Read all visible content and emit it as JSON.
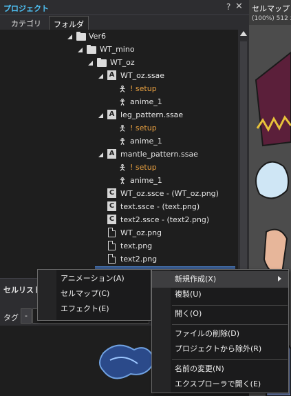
{
  "project_panel": {
    "title": "プロジェクト",
    "help": "?",
    "close": "✕",
    "tabs": [
      {
        "label": "カテゴリ"
      },
      {
        "label": "フォルダ"
      }
    ],
    "tree": [
      {
        "label": "Ver6"
      },
      {
        "label": "WT_mino"
      },
      {
        "label": "WT_oz"
      },
      {
        "label": "WT_oz.ssae",
        "badge": "A"
      },
      {
        "label": "! setup"
      },
      {
        "label": "anime_1"
      },
      {
        "label": "leg_pattern.ssae",
        "badge": "A"
      },
      {
        "label": "! setup"
      },
      {
        "label": "anime_1"
      },
      {
        "label": "mantle_pattern.ssae",
        "badge": "A"
      },
      {
        "label": "! setup"
      },
      {
        "label": "anime_1"
      },
      {
        "label": "WT_oz.ssce - (WT_oz.png)",
        "badge": "C"
      },
      {
        "label": "text.ssce - (text.png)",
        "badge": "C"
      },
      {
        "label": "text2.ssce - (text2.png)",
        "badge": "C"
      },
      {
        "label": "WT_oz.png"
      },
      {
        "label": "text.png"
      },
      {
        "label": "text2.png"
      }
    ]
  },
  "cellmap_panel": {
    "title": "セルマップ",
    "zoom": "(100%) 512 x"
  },
  "celllist_panel": {
    "title": "セルリスト",
    "tag_label": "タグ",
    "tag_minus": "-"
  },
  "submenu": {
    "items": [
      {
        "label": "アニメーション(A)"
      },
      {
        "label": "セルマップ(C)"
      },
      {
        "label": "エフェクト(E)"
      }
    ]
  },
  "context_menu": {
    "items": [
      {
        "label": "新規作成(X)"
      },
      {
        "label": "複製(U)"
      },
      {
        "label": "開く(O)"
      },
      {
        "label": "ファイルの削除(D)"
      },
      {
        "label": "プロジェクトから除外(R)"
      },
      {
        "label": "名前の変更(N)"
      },
      {
        "label": "エクスプローラで開く(E)"
      }
    ]
  },
  "colors": {
    "panel_title": "#4fc3f7",
    "setup_orange": "#e8a040",
    "menu_bg": "#1b1b1c"
  }
}
